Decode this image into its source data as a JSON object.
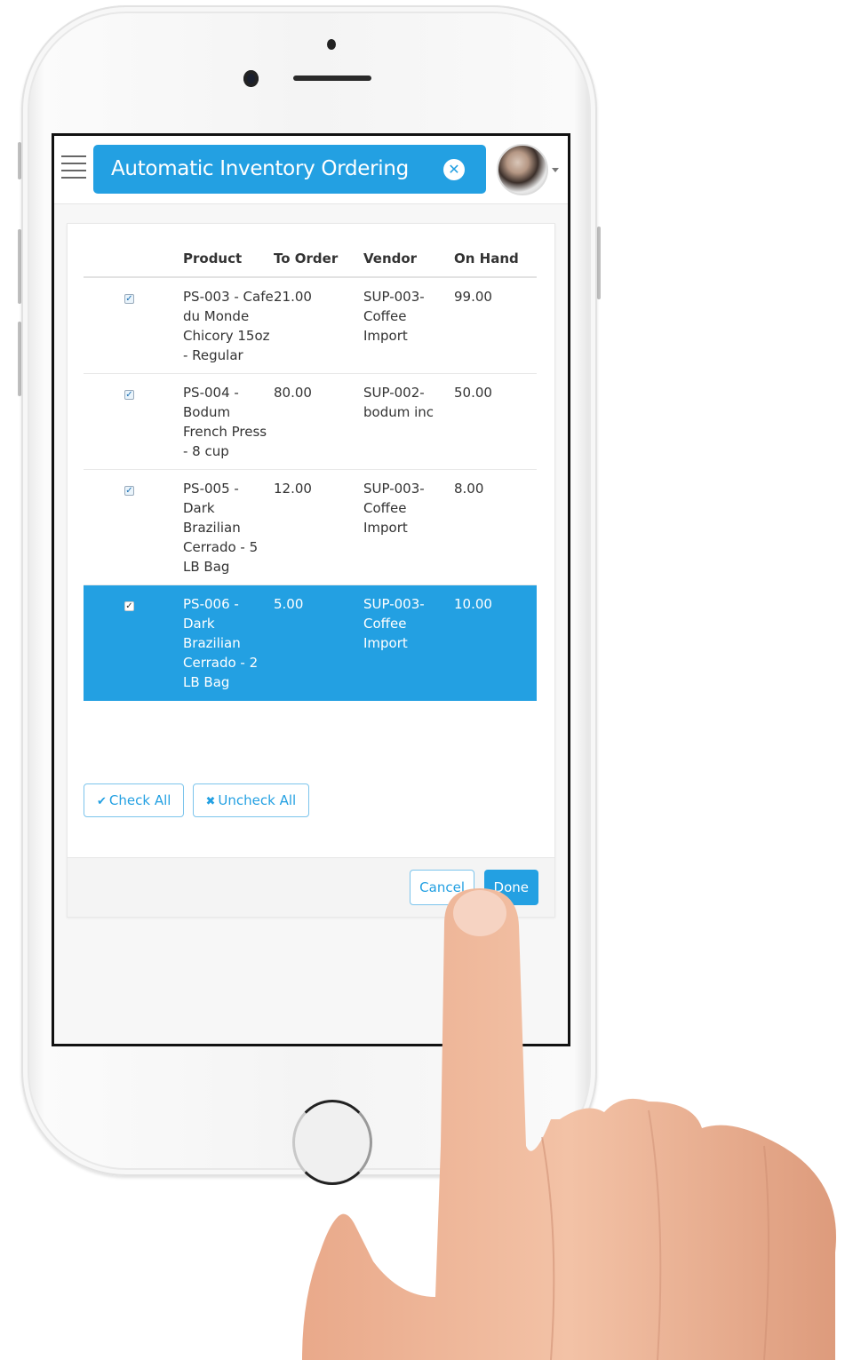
{
  "header": {
    "title": "Automatic Inventory Ordering",
    "close_icon": "times-circle-icon",
    "menu_icon": "hamburger-icon",
    "avatar_caret_icon": "caret-down-icon"
  },
  "table": {
    "columns": [
      "",
      "Product",
      "To Order",
      "Vendor",
      "On Hand"
    ],
    "rows": [
      {
        "checked": true,
        "product": "PS-003 - Cafe du Monde Chicory 15oz - Regular",
        "to_order": "21.00",
        "vendor": "SUP-003-Coffee Import",
        "on_hand": "99.00",
        "selected": false
      },
      {
        "checked": true,
        "product": "PS-004 - Bodum French Press - 8 cup",
        "to_order": "80.00",
        "vendor": "SUP-002-bodum inc",
        "on_hand": "50.00",
        "selected": false
      },
      {
        "checked": true,
        "product": "PS-005 - Dark Brazilian Cerrado - 5 LB Bag",
        "to_order": "12.00",
        "vendor": "SUP-003-Coffee Import",
        "on_hand": "8.00",
        "selected": false
      },
      {
        "checked": true,
        "product": "PS-006 - Dark Brazilian Cerrado - 2 LB Bag",
        "to_order": "5.00",
        "vendor": "SUP-003-Coffee Import",
        "on_hand": "10.00",
        "selected": true
      }
    ]
  },
  "actions": {
    "check_all": "Check All",
    "check_all_icon": "✔",
    "uncheck_all": "Uncheck All",
    "uncheck_all_icon": "✖",
    "cancel": "Cancel",
    "done": "Done"
  },
  "colors": {
    "accent": "#23a0e2",
    "selected_row": "#23a0e2"
  }
}
